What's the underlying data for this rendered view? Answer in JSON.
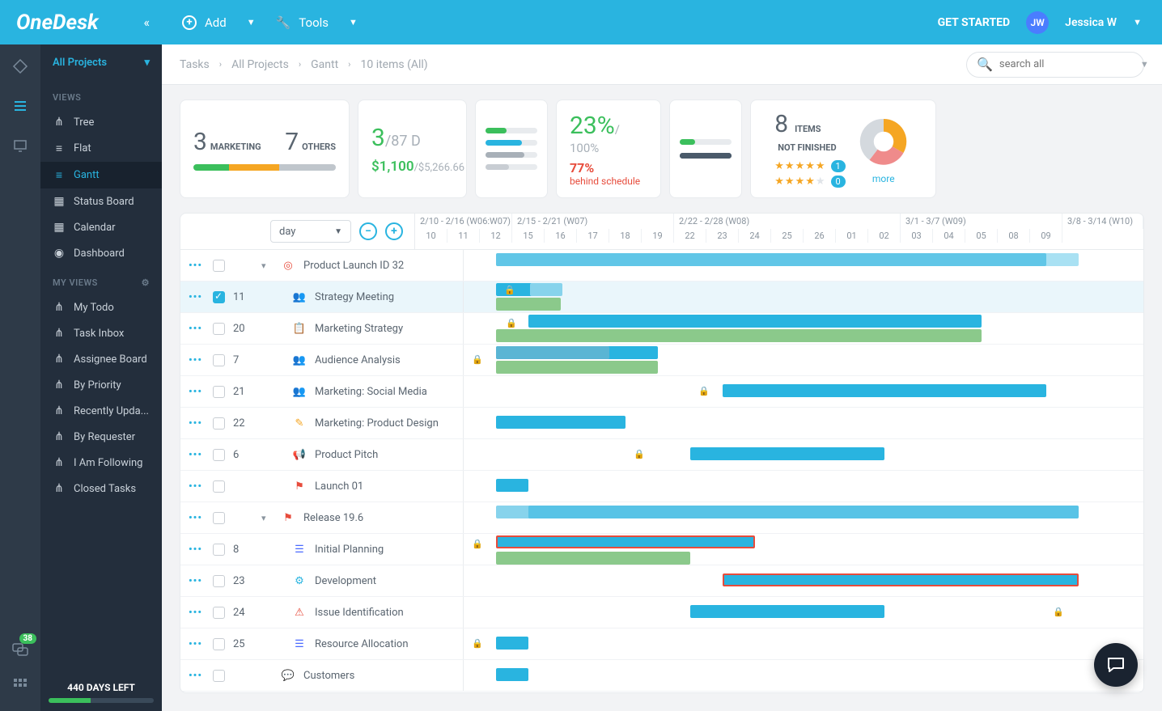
{
  "app": {
    "name": "OneDesk"
  },
  "topbar": {
    "add": "Add",
    "tools": "Tools",
    "get_started": "GET STARTED",
    "avatar": "JW",
    "user": "Jessica W"
  },
  "sidebar": {
    "project_selector": "All Projects",
    "views_label": "VIEWS",
    "myviews_label": "MY VIEWS",
    "views": [
      "Tree",
      "Flat",
      "Gantt",
      "Status Board",
      "Calendar",
      "Dashboard"
    ],
    "myviews": [
      "My Todo",
      "Task Inbox",
      "Assignee Board",
      "By Priority",
      "Recently Upda...",
      "By Requester",
      "I Am Following",
      "Closed Tasks"
    ],
    "days_left": "440 DAYS LEFT"
  },
  "breadcrumbs": [
    "Tasks",
    "All Projects",
    "Gantt",
    "10 items (All)"
  ],
  "search": {
    "placeholder": "search all"
  },
  "cards": {
    "c1": {
      "a_num": "3",
      "a_lbl": "MARKETING",
      "b_num": "7",
      "b_lbl": "OTHERS"
    },
    "c2": {
      "top_a": "3",
      "top_b": "/87 D",
      "bot_a": "$1,100",
      "bot_b": "/$5,266.66"
    },
    "c4": {
      "pct": "23%",
      "suffix": "/ 100%",
      "behind_pct": "77%",
      "behind_lbl": "behind schedule"
    },
    "c6": {
      "num": "8",
      "l1": "ITEMS",
      "l2": "NOT FINISHED",
      "pill1": "1",
      "pill2": "0",
      "more": "more"
    }
  },
  "gantt": {
    "scale": "day",
    "weeks": [
      "2/10 - 2/16 (W06:W07)",
      "2/15 - 2/21 (W07)",
      "2/22 - 2/28 (W08)",
      "3/1 - 3/7 (W09)",
      "3/8 - 3/14 (W10)"
    ],
    "days": [
      "10",
      "11",
      "12",
      "15",
      "16",
      "17",
      "18",
      "19",
      "22",
      "23",
      "24",
      "25",
      "26",
      "01",
      "02",
      "03",
      "04",
      "05",
      "08",
      "09"
    ],
    "rows": [
      {
        "id": "",
        "name": "Product Launch ID 32",
        "icon": "target",
        "exp": "▾",
        "indent": 0
      },
      {
        "id": "11",
        "name": "Strategy Meeting",
        "icon": "people",
        "indent": 1,
        "checked": true
      },
      {
        "id": "20",
        "name": "Marketing Strategy",
        "icon": "clipboard",
        "indent": 1
      },
      {
        "id": "7",
        "name": "Audience Analysis",
        "icon": "people",
        "indent": 1
      },
      {
        "id": "21",
        "name": "Marketing: Social Media",
        "icon": "people",
        "indent": 1
      },
      {
        "id": "22",
        "name": "Marketing: Product Design",
        "icon": "pencil",
        "indent": 1
      },
      {
        "id": "6",
        "name": "Product Pitch",
        "icon": "megaphone",
        "indent": 1
      },
      {
        "id": "",
        "name": "Launch 01",
        "icon": "flag-red",
        "indent": 1
      },
      {
        "id": "",
        "name": "Release 19.6",
        "icon": "flag-red",
        "exp": "▾",
        "indent": 0
      },
      {
        "id": "8",
        "name": "Initial Planning",
        "icon": "list",
        "indent": 1
      },
      {
        "id": "23",
        "name": "Development",
        "icon": "gear-blue",
        "indent": 1
      },
      {
        "id": "24",
        "name": "Issue Identification",
        "icon": "warn",
        "indent": 1
      },
      {
        "id": "25",
        "name": "Resource Allocation",
        "icon": "list",
        "indent": 1
      },
      {
        "id": "",
        "name": "Customers",
        "icon": "chat",
        "indent": 0
      }
    ]
  }
}
